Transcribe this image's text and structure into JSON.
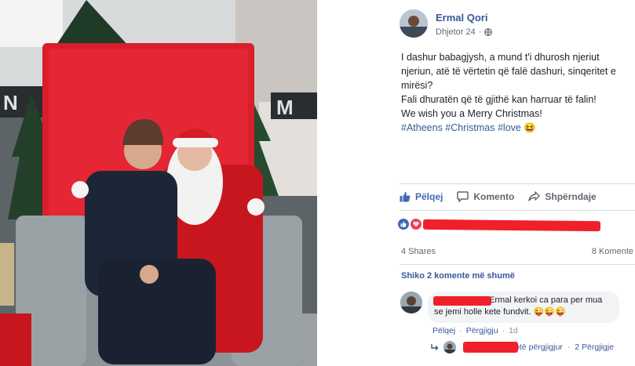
{
  "post": {
    "author": "Ermal Qori",
    "date": "Dhjetor 24",
    "privacy_icon": "globe-icon",
    "text_lines": [
      "I dashur babagjysh, a mund t'i dhurosh njeriut",
      "njeriun, atë të vërtetin që falë dashuri, sinqeritet e",
      "mirësi?",
      "Fali dhuratën që të gjithë kan harruar të falin!",
      "We wish you a Merry Christmas!"
    ],
    "hashtags": "#Atheens #Christmas #love 😆"
  },
  "actions": {
    "like": "Pëlqej",
    "comment": "Komento",
    "share": "Shpërndaje"
  },
  "stats": {
    "shares": "4 Shares",
    "comments": "8 Komente"
  },
  "comments": {
    "show_more": "Shiko 2 komente më shumë",
    "first": {
      "text_line1": "Ermal kerkoi ca para per mua",
      "text_line2": "se jemi holle kete fundvit. 😜😜😜",
      "like": "Pëlqej",
      "reply": "Përgjigju",
      "time": "1d"
    },
    "reply_summary": {
      "partial_text": "është përgjigjur",
      "count": "2 Përgjigje"
    }
  },
  "colors": {
    "link": "#385898",
    "like_blue": "#4267b2",
    "love_red": "#f33e58",
    "redaction": "#f0202a"
  }
}
